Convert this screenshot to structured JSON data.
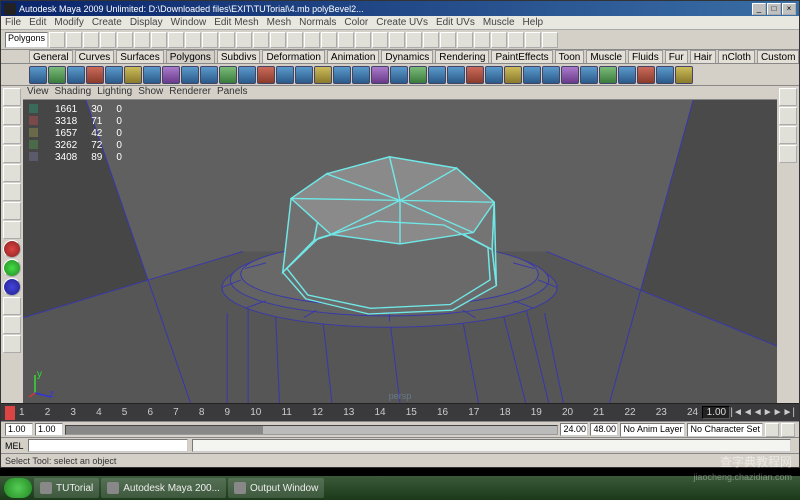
{
  "titlebar": {
    "title": "Autodesk Maya 2009 Unlimited: D:\\Downloaded files\\EXIT\\TUTorial\\4.mb    polyBevel2...",
    "min": "_",
    "max": "□",
    "close": "×"
  },
  "menus": [
    "File",
    "Edit",
    "Modify",
    "Create",
    "Display",
    "Window",
    "Edit Mesh",
    "Mesh",
    "Normals",
    "Color",
    "Create UVs",
    "Edit UVs",
    "Muscle",
    "Help"
  ],
  "shelf_tabs": [
    "General",
    "Curves",
    "Surfaces",
    "Polygons",
    "Subdivs",
    "Deformation",
    "Animation",
    "Dynamics",
    "Rendering",
    "PaintEffects",
    "Toon",
    "Muscle",
    "Fluids",
    "Fur",
    "Hair",
    "nCloth",
    "Custom"
  ],
  "shelf_active": "Polygons",
  "toolbar_dropdown": "Polygons",
  "vp_menus": [
    "View",
    "Shading",
    "Lighting",
    "Show",
    "Renderer",
    "Panels"
  ],
  "hud": {
    "rows": [
      {
        "c": "#3a6a5a",
        "a": "1661",
        "b": "30",
        "d": "0"
      },
      {
        "c": "#7a4a4a",
        "a": "3318",
        "b": "71",
        "d": "0"
      },
      {
        "c": "#6a6a4a",
        "a": "1657",
        "b": "42",
        "d": "0"
      },
      {
        "c": "#4a6a4a",
        "a": "3262",
        "b": "72",
        "d": "0"
      },
      {
        "c": "#5a5a6a",
        "a": "3408",
        "b": "89",
        "d": "0"
      }
    ]
  },
  "persp": "persp",
  "timeline": {
    "ticks": [
      "1",
      "2",
      "3",
      "4",
      "5",
      "6",
      "7",
      "8",
      "9",
      "10",
      "11",
      "12",
      "13",
      "14",
      "15",
      "16",
      "17",
      "18",
      "19",
      "20",
      "21",
      "22",
      "23",
      "24"
    ],
    "current": "1.00"
  },
  "range": {
    "start": "1.00",
    "startplay": "1.00",
    "endplay": "24.00",
    "end": "48.00",
    "anim_layer": "No Anim Layer",
    "char_set": "No Character Set"
  },
  "cmdline": {
    "label": "MEL"
  },
  "status": "Select Tool: select an object",
  "taskbar": {
    "items": [
      "TUTorial",
      "Autodesk Maya 200...",
      "Output Window"
    ]
  },
  "watermark": "查字典教程网",
  "watermark2": "jiaocheng.chazidian.com",
  "axis": {
    "y": "y",
    "z": "z"
  }
}
